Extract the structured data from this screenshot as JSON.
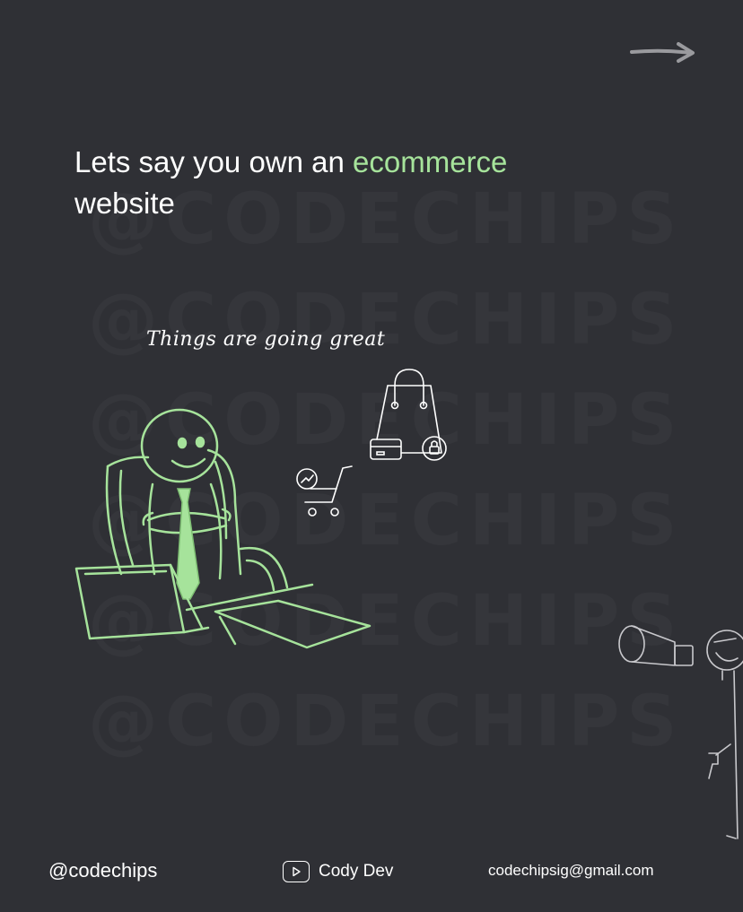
{
  "watermark": {
    "text": "@CODECHIPS"
  },
  "headline": {
    "prefix": "Lets say you own an ",
    "highlight": "ecommerce",
    "suffix": "website"
  },
  "caption": "Things are going great",
  "footer": {
    "handle": "@codechips",
    "channel": "Cody Dev",
    "email": "codechipsig@gmail.com"
  },
  "colors": {
    "background": "#2f3035",
    "accent": "#a6e39b",
    "watermark": "#35363b"
  },
  "icons": [
    "arrow-right-icon",
    "shopping-bag-icon",
    "credit-card-icon",
    "lock-icon",
    "shopping-cart-icon",
    "trend-up-icon",
    "play-icon"
  ]
}
